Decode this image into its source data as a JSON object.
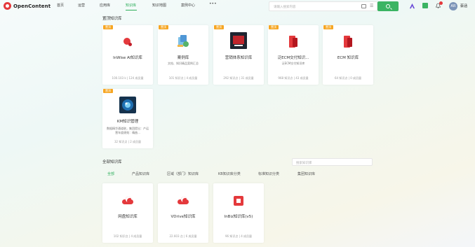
{
  "header": {
    "logo_text": "OpenContent",
    "nav": [
      {
        "label": "首页",
        "active": false
      },
      {
        "label": "运营",
        "active": false
      },
      {
        "label": "应用库",
        "active": false
      },
      {
        "label": "知识库",
        "active": true
      },
      {
        "label": "知识地图",
        "active": false
      },
      {
        "label": "案例中心",
        "active": false
      }
    ],
    "more": "•••",
    "search_placeholder": "请输入搜索内容",
    "avatar_text": "AR",
    "username": "蔡涵",
    "brand_green": "#3bb463",
    "brand_red": "#e4393c"
  },
  "featured": {
    "title": "置顶知识库",
    "cards": [
      {
        "tag": "置顶",
        "name": "InWise AI知识库",
        "desc": "",
        "meta": "100.103 k | 124 成员量",
        "icon": "red-blob-icon"
      },
      {
        "tag": "置顶",
        "name": "案例库",
        "desc": "文档、知识精品案例汇总",
        "meta": "101 知识点 | 4 成员量",
        "icon": "case-library-icon"
      },
      {
        "tag": "置顶",
        "name": "营销体系知识库",
        "desc": "",
        "meta": "292 知识点 | 31 成员量",
        "icon": "marketing-icon"
      },
      {
        "tag": "置顶",
        "name": "泛ECM交付知识...",
        "desc": "泛ECM交付知识库",
        "meta": "968 知识点 | 43 成员量",
        "icon": "book-icon"
      },
      {
        "tag": "置顶",
        "name": "ECM 知识库",
        "desc": "",
        "meta": "64 知识点 | 0 成员量",
        "icon": "book-icon"
      },
      {
        "tag": "置顶",
        "name": "KM知识管理",
        "desc": "数据精华通道联，集团提出：产运营年度绩效：精曲...",
        "meta": "32 知识点 | 2 成员量",
        "icon": "km-icon"
      }
    ]
  },
  "all": {
    "title": "全部知识库",
    "search_placeholder": "搜索知识库",
    "filters": [
      {
        "label": "全部",
        "active": true
      },
      {
        "label": "产品知识库",
        "active": false
      },
      {
        "label": "区域（部门）知识库",
        "active": false
      },
      {
        "label": "KB知识库分类",
        "active": false
      },
      {
        "label": "标准知识分类",
        "active": false
      },
      {
        "label": "集团知识库",
        "active": false
      }
    ],
    "cards": [
      {
        "name": "网盘知识库",
        "meta": "102 知识点 | 4 成员量",
        "icon": "cloud-icon"
      },
      {
        "name": "VDrive知识库",
        "meta": "22.603 点 | 6 成员量",
        "icon": "cloud-icon"
      },
      {
        "name": "InBiz知识库(v5)",
        "meta": "96 知识点 | 4 成员量",
        "icon": "inbiz-icon"
      }
    ]
  }
}
